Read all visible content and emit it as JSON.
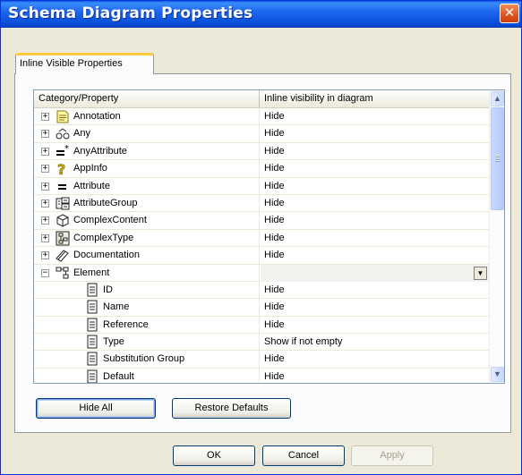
{
  "window": {
    "title": "Schema Diagram Properties",
    "close_glyph": "✕"
  },
  "tab": {
    "label": "Inline Visible Properties"
  },
  "grid": {
    "headers": {
      "category": "Category/Property",
      "visibility": "Inline visibility in diagram"
    },
    "rows": [
      {
        "name": "Annotation",
        "value": "Hide",
        "icon": "annotation-icon",
        "level": 0,
        "expander": "+"
      },
      {
        "name": "Any",
        "value": "Hide",
        "icon": "any-icon",
        "level": 0,
        "expander": "+"
      },
      {
        "name": "AnyAttribute",
        "value": "Hide",
        "icon": "anyattribute-icon",
        "level": 0,
        "expander": "+"
      },
      {
        "name": "AppInfo",
        "value": "Hide",
        "icon": "appinfo-icon",
        "level": 0,
        "expander": "+"
      },
      {
        "name": "Attribute",
        "value": "Hide",
        "icon": "attribute-icon",
        "level": 0,
        "expander": "+"
      },
      {
        "name": "AttributeGroup",
        "value": "Hide",
        "icon": "attributegroup-icon",
        "level": 0,
        "expander": "+"
      },
      {
        "name": "ComplexContent",
        "value": "Hide",
        "icon": "complexcontent-icon",
        "level": 0,
        "expander": "+"
      },
      {
        "name": "ComplexType",
        "value": "Hide",
        "icon": "complextype-icon",
        "level": 0,
        "expander": "+"
      },
      {
        "name": "Documentation",
        "value": "Hide",
        "icon": "documentation-icon",
        "level": 0,
        "expander": "+"
      },
      {
        "name": "Element",
        "value": "",
        "icon": "element-icon",
        "level": 0,
        "expander": "−",
        "combo": true
      },
      {
        "name": "ID",
        "value": "Hide",
        "icon": "property-icon",
        "level": 1
      },
      {
        "name": "Name",
        "value": "Hide",
        "icon": "property-icon",
        "level": 1
      },
      {
        "name": "Reference",
        "value": "Hide",
        "icon": "property-icon",
        "level": 1
      },
      {
        "name": "Type",
        "value": "Show if not empty",
        "icon": "property-icon",
        "level": 1
      },
      {
        "name": "Substitution Group",
        "value": "Hide",
        "icon": "property-icon",
        "level": 1
      },
      {
        "name": "Default",
        "value": "Hide",
        "icon": "property-icon",
        "level": 1
      }
    ]
  },
  "buttons": {
    "hide_all": "Hide All",
    "restore_defaults": "Restore Defaults",
    "ok": "OK",
    "cancel": "Cancel",
    "apply": "Apply"
  },
  "scrollbar": {
    "up_glyph": "▲",
    "down_glyph": "▼"
  },
  "colors": {
    "titlebar": "#0a5fe6",
    "tab_highlight": "#ffc73c",
    "panel_bg": "#ece9d8"
  }
}
